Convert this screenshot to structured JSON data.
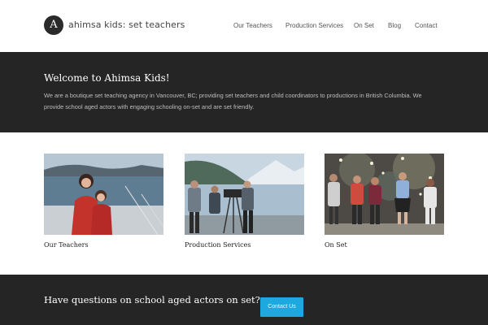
{
  "header": {
    "logo_letter": "A",
    "site_title": "ahimsa kids: set teachers",
    "nav": [
      "Our Teachers",
      "Production Services",
      "On Set",
      "Blog",
      "Contact"
    ]
  },
  "welcome": {
    "title": "Welcome to Ahimsa Kids!",
    "text": "We are a boutique set teaching agency in Vancouver, BC; providing set teachers and child coordinators to productions in British Columbia. We provide school aged actors with engaging schooling on-set and are set friendly."
  },
  "cards": [
    {
      "label": "Our Teachers"
    },
    {
      "label": "Production Services"
    },
    {
      "label": "On Set"
    }
  ],
  "footer": {
    "question": "Have questions on school aged actors on set?",
    "button_label": "Contact Us"
  },
  "colors": {
    "dark_band": "#252525",
    "accent": "#1ea8e0"
  }
}
